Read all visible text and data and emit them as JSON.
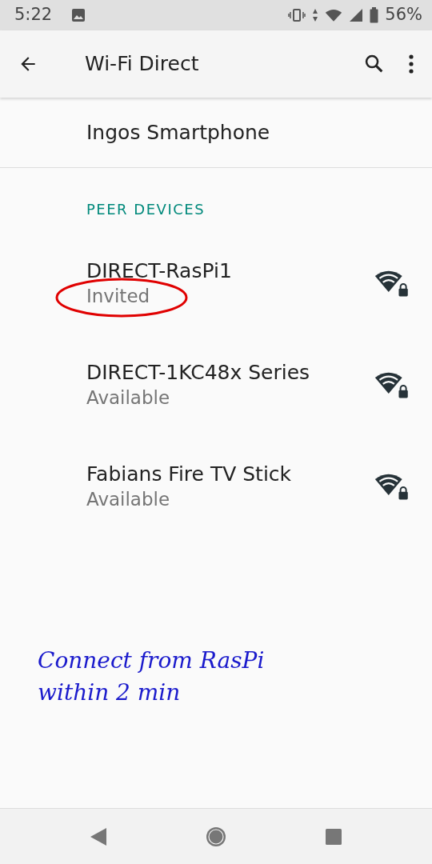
{
  "status_bar": {
    "time": "5:22",
    "battery": "56%"
  },
  "app_bar": {
    "title": "Wi-Fi Direct"
  },
  "device_name": "Ingos Smartphone",
  "section": {
    "title": "PEER DEVICES"
  },
  "peers": [
    {
      "name": "DIRECT-RasPi1",
      "status": "Invited",
      "circled": true
    },
    {
      "name": "DIRECT-1KC48x Series",
      "status": "Available",
      "circled": false
    },
    {
      "name": "Fabians Fire TV Stick",
      "status": "Available",
      "circled": false
    }
  ],
  "annotation": {
    "lines": [
      "Connect from RasPi",
      "within 2 min"
    ]
  }
}
